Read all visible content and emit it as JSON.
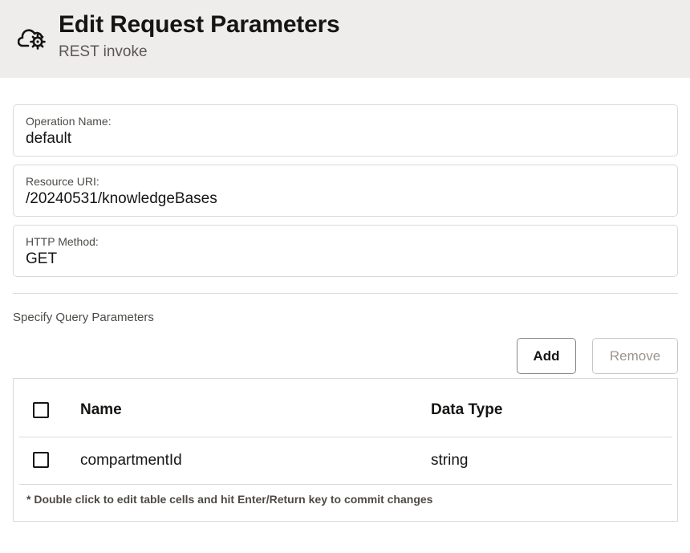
{
  "header": {
    "icon": "cloud-gear-icon",
    "title": "Edit Request Parameters",
    "subtitle": "REST invoke"
  },
  "fields": {
    "operation_name": {
      "label": "Operation Name:",
      "value": "default"
    },
    "resource_uri": {
      "label": "Resource URI:",
      "value": "/20240531/knowledgeBases"
    },
    "http_method": {
      "label": "HTTP Method:",
      "value": "GET"
    }
  },
  "query_params": {
    "section_label": "Specify Query Parameters",
    "add_label": "Add",
    "remove_label": "Remove",
    "columns": {
      "name": "Name",
      "data_type": "Data Type"
    },
    "rows": [
      {
        "name": "compartmentId",
        "data_type": "string",
        "checked": false
      }
    ],
    "note": "* Double click to edit table cells and hit Enter/Return key to commit changes"
  }
}
